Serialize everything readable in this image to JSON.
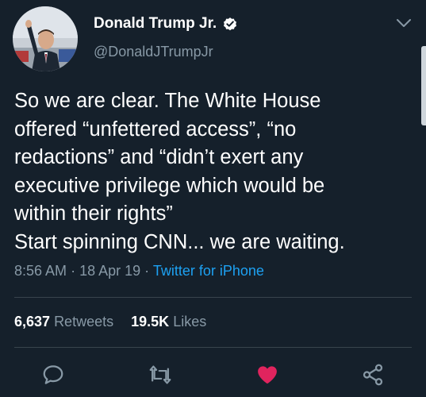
{
  "tweet": {
    "author": {
      "display_name": "Donald Trump Jr.",
      "handle": "@DonaldJTrumpJr",
      "verified": true,
      "avatar_icon": "profile-photo"
    },
    "text_lines": [
      "So we are clear. The White House",
      "offered “unfettered access”, “no",
      "redactions” and “didn’t exert any",
      "executive privilege which would be",
      "within their rights”",
      "Start spinning CNN... we are waiting."
    ],
    "time": "8:56 AM",
    "date": "18 Apr 19",
    "separator": "·",
    "source": "Twitter for iPhone",
    "stats": {
      "retweets_count": "6,637",
      "retweets_label": "Retweets",
      "likes_count": "19.5K",
      "likes_label": "Likes"
    },
    "actions": [
      {
        "name": "reply",
        "icon": "speech-bubble-icon"
      },
      {
        "name": "retweet",
        "icon": "retweet-icon"
      },
      {
        "name": "like",
        "icon": "heart-icon",
        "active": true
      },
      {
        "name": "share",
        "icon": "share-icon"
      }
    ]
  },
  "colors": {
    "background": "#15202b",
    "text": "#ffffff",
    "secondary_text": "#8899a6",
    "link": "#1da1f2",
    "like_active": "#e0245e",
    "divider": "#38444d"
  }
}
